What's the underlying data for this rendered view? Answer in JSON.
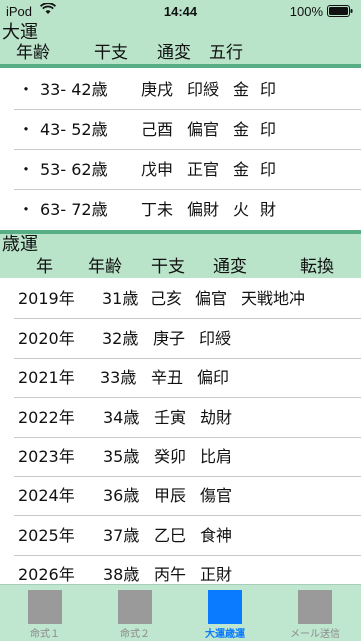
{
  "status_bar": {
    "carrier": "iPod",
    "time": "14:44",
    "battery_percent": "100%"
  },
  "daiun": {
    "title": "大運",
    "columns": [
      "年齢",
      "干支",
      "通変",
      "五行"
    ],
    "rows": [
      {
        "bullet": "・",
        "age": "33- 42歳",
        "kanshi": "庚戌",
        "tsuhen": "印綬",
        "gogyo1": "金",
        "gogyo2": "印"
      },
      {
        "bullet": "・",
        "age": "43- 52歳",
        "kanshi": "己酉",
        "tsuhen": "偏官",
        "gogyo1": "金",
        "gogyo2": "印"
      },
      {
        "bullet": "・",
        "age": "53- 62歳",
        "kanshi": "戊申",
        "tsuhen": "正官",
        "gogyo1": "金",
        "gogyo2": "印"
      },
      {
        "bullet": "・",
        "age": "63- 72歳",
        "kanshi": "丁未",
        "tsuhen": "偏財",
        "gogyo1": "火",
        "gogyo2": "財"
      }
    ]
  },
  "saiun": {
    "title": "歳運",
    "columns": [
      "年",
      "年齢",
      "干支",
      "通変",
      "転換"
    ],
    "rows": [
      {
        "year": "2019年",
        "age": "31歳",
        "kanshi": "己亥",
        "tsuhen": "偏官",
        "tenkan": "天戦地冲"
      },
      {
        "year": "2020年",
        "age": "32歳",
        "kanshi": "庚子",
        "tsuhen": "印綬",
        "tenkan": ""
      },
      {
        "year": "2021年",
        "age": "33歳",
        "kanshi": "辛丑",
        "tsuhen": "偏印",
        "tenkan": ""
      },
      {
        "year": "2022年",
        "age": "34歳",
        "kanshi": "壬寅",
        "tsuhen": "劫財",
        "tenkan": ""
      },
      {
        "year": "2023年",
        "age": "35歳",
        "kanshi": "癸卯",
        "tsuhen": "比肩",
        "tenkan": ""
      },
      {
        "year": "2024年",
        "age": "36歳",
        "kanshi": "甲辰",
        "tsuhen": "傷官",
        "tenkan": ""
      },
      {
        "year": "2025年",
        "age": "37歳",
        "kanshi": "乙巳",
        "tsuhen": "食神",
        "tenkan": ""
      },
      {
        "year": "2026年",
        "age": "38歳",
        "kanshi": "丙午",
        "tsuhen": "正財",
        "tenkan": ""
      }
    ]
  },
  "tabs": [
    {
      "label": "命式１",
      "active": false
    },
    {
      "label": "命式２",
      "active": false
    },
    {
      "label": "大運歳運",
      "active": true
    },
    {
      "label": "メール送信",
      "active": false
    }
  ],
  "colors": {
    "header_bg": "#b9e4c9",
    "rule": "#58ae84",
    "tab_active": "#0a7aff",
    "tab_inactive": "#9a9a9a"
  }
}
